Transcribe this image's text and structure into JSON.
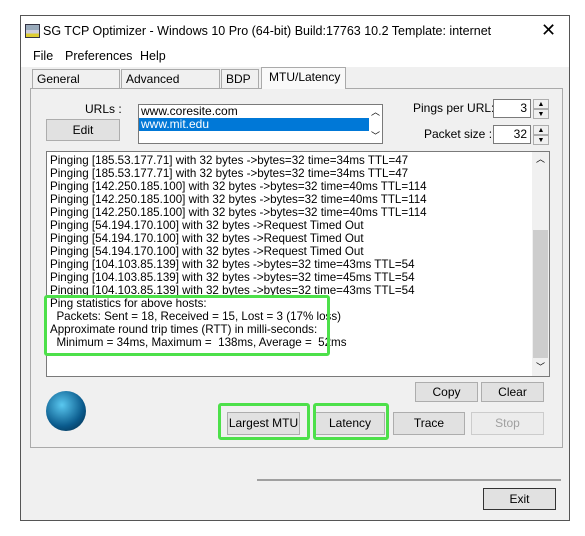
{
  "window": {
    "title": "SG TCP Optimizer - Windows 10 Pro (64-bit) Build:17763 10.2  Template: internet"
  },
  "menu": [
    "File",
    "Preferences",
    "Help"
  ],
  "tabs": [
    {
      "label": "General Settings"
    },
    {
      "label": "Advanced Settings"
    },
    {
      "label": "BDP"
    },
    {
      "label": "MTU/Latency",
      "active": true
    }
  ],
  "urls": {
    "label": "URLs :",
    "edit_label": "Edit",
    "items": [
      "www.coresite.com",
      "www.mit.edu"
    ],
    "selected": "www.mit.edu"
  },
  "pings": {
    "label": "Pings per URL:",
    "value": "3"
  },
  "packet": {
    "label": "Packet size :",
    "value": "32"
  },
  "output": {
    "lines": [
      "Pinging [185.53.177.71] with 32 bytes ->bytes=32 time=34ms TTL=47",
      "Pinging [185.53.177.71] with 32 bytes ->bytes=32 time=34ms TTL=47",
      "Pinging [142.250.185.100] with 32 bytes ->bytes=32 time=40ms TTL=114",
      "Pinging [142.250.185.100] with 32 bytes ->bytes=32 time=40ms TTL=114",
      "Pinging [142.250.185.100] with 32 bytes ->bytes=32 time=40ms TTL=114",
      "Pinging [54.194.170.100] with 32 bytes ->Request Timed Out",
      "Pinging [54.194.170.100] with 32 bytes ->Request Timed Out",
      "Pinging [54.194.170.100] with 32 bytes ->Request Timed Out",
      "Pinging [104.103.85.139] with 32 bytes ->bytes=32 time=43ms TTL=54",
      "Pinging [104.103.85.139] with 32 bytes ->bytes=32 time=45ms TTL=54",
      "Pinging [104.103.85.139] with 32 bytes ->bytes=32 time=43ms TTL=54",
      "Ping statistics for above hosts:",
      "  Packets: Sent = 18, Received = 15, Lost = 3 (17% loss)",
      "Approximate round trip times (RTT) in milli-seconds:",
      "  Minimum = 34ms, Maximum =  138ms, Average =  52ms"
    ]
  },
  "buttons": {
    "copy": "Copy",
    "clear": "Clear",
    "largest_mtu": "Largest MTU",
    "latency": "Latency",
    "trace": "Trace",
    "stop": "Stop",
    "exit": "Exit"
  },
  "colors": {
    "highlight": "#4de04a",
    "selection": "#0078d7"
  }
}
